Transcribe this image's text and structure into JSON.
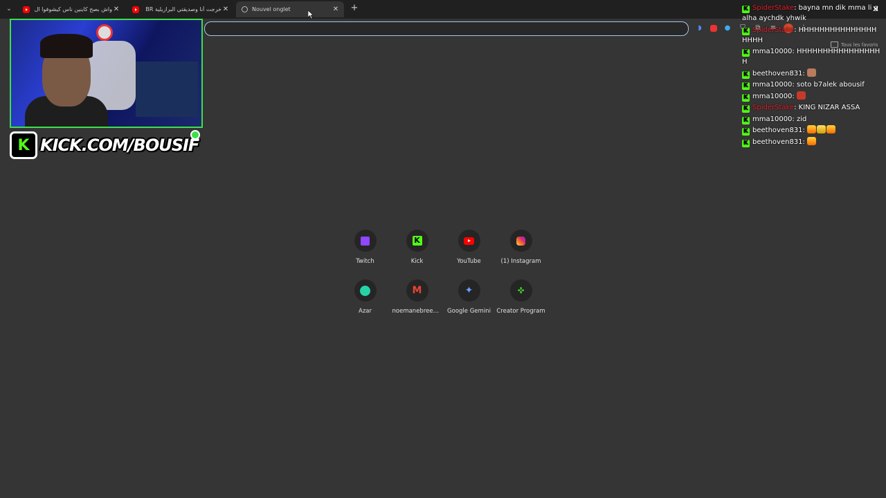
{
  "tabs": [
    {
      "title": "واش بصح كاينين ناس كيشوفوا ال...",
      "favicon": "youtube-icon"
    },
    {
      "title": "خرجت أنا وصديقتي البرازيلية BR ...",
      "favicon": "youtube-icon"
    },
    {
      "title": "Nouvel onglet",
      "favicon": "globe-icon",
      "active": true
    }
  ],
  "bookmarks": {
    "all_bookmarks": "Tous les favoris"
  },
  "overlay": {
    "banner_text": "KICK.COM/BOUSIF",
    "logo_letter": "K"
  },
  "chat": [
    {
      "user": "SpiderStake",
      "user_color": "#e0202a",
      "text": "bayna mn dik mma li galha aychdk yhwik"
    },
    {
      "user": "SpiderStake",
      "user_color": "#e0202a",
      "text": "HHHHHHHHHHHHHHHHHHH"
    },
    {
      "user": "mma10000",
      "user_color": "#ffffff",
      "text": "HHHHHHHHHHHHHHHHH"
    },
    {
      "user": "beethoven831",
      "user_color": "#ffffff",
      "text": "",
      "emotes": [
        "face"
      ]
    },
    {
      "user": "mma10000",
      "user_color": "#ffffff",
      "text": "soto b7alek abousif"
    },
    {
      "user": "mma10000",
      "user_color": "#ffffff",
      "text": "",
      "emotes": [
        "angry"
      ]
    },
    {
      "user": "SpiderStake",
      "user_color": "#e0202a",
      "text": "KING NIZAR ASSA"
    },
    {
      "user": "mma10000",
      "user_color": "#ffffff",
      "text": "zid"
    },
    {
      "user": "beethoven831",
      "user_color": "#ffffff",
      "text": "",
      "emotes": [
        "fire",
        "crown",
        "fire"
      ]
    },
    {
      "user": "beethoven831",
      "user_color": "#ffffff",
      "text": "",
      "emotes": [
        "fire"
      ]
    }
  ],
  "shortcuts": [
    {
      "label": "Twitch",
      "icon": "twitch-icon"
    },
    {
      "label": "Kick",
      "icon": "kick-icon"
    },
    {
      "label": "YouTube",
      "icon": "youtube-icon"
    },
    {
      "label": "(1) Instagram",
      "icon": "instagram-icon"
    },
    {
      "label": "Azar",
      "icon": "azar-icon"
    },
    {
      "label": "noemanebreezy...",
      "icon": "gmail-icon"
    },
    {
      "label": "Google Gemini",
      "icon": "gemini-icon"
    },
    {
      "label": "Creator Program",
      "icon": "razer-icon"
    }
  ]
}
